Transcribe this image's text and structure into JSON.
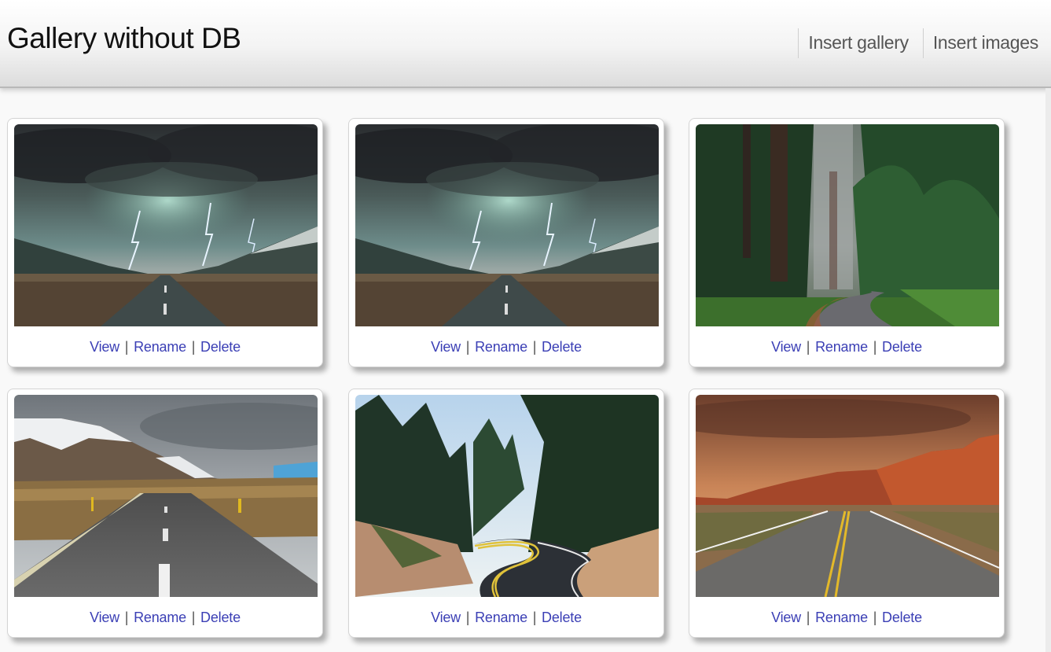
{
  "header": {
    "title": "Gallery without DB",
    "nav": [
      {
        "label": "Insert gallery"
      },
      {
        "label": "Insert images"
      }
    ]
  },
  "gallery": {
    "separator": "|",
    "cards": [
      {
        "scene": "storm-road",
        "view_label": "View",
        "rename_label": "Rename",
        "delete_label": "Delete"
      },
      {
        "scene": "storm-road",
        "view_label": "View",
        "rename_label": "Rename",
        "delete_label": "Delete"
      },
      {
        "scene": "forest-road",
        "view_label": "View",
        "rename_label": "Rename",
        "delete_label": "Delete"
      },
      {
        "scene": "mountain-road",
        "view_label": "View",
        "rename_label": "Rename",
        "delete_label": "Delete"
      },
      {
        "scene": "pine-curve-road",
        "view_label": "View",
        "rename_label": "Rename",
        "delete_label": "Delete"
      },
      {
        "scene": "desert-road",
        "view_label": "View",
        "rename_label": "Rename",
        "delete_label": "Delete"
      }
    ]
  },
  "colors": {
    "link": "#3b3fb5",
    "page_background": "#f9f9f9"
  }
}
